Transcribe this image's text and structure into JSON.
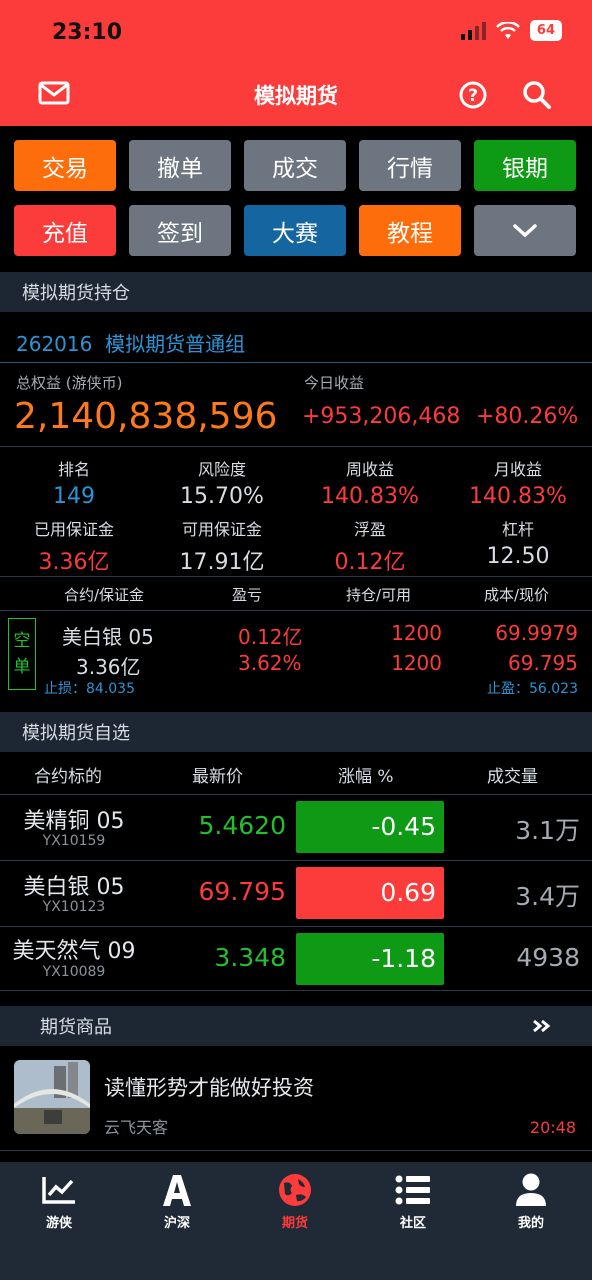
{
  "status": {
    "time": "23:10",
    "battery": "64"
  },
  "nav": {
    "title": "模拟期货"
  },
  "buttons": [
    {
      "label": "交易",
      "color": "#fd6d0c"
    },
    {
      "label": "撤单",
      "color": "#6c7580"
    },
    {
      "label": "成交",
      "color": "#6c7580"
    },
    {
      "label": "行情",
      "color": "#6c7580"
    },
    {
      "label": "银期",
      "color": "#0e9a14"
    },
    {
      "label": "充值",
      "color": "#fc3b3b"
    },
    {
      "label": "签到",
      "color": "#6c7580"
    },
    {
      "label": "大赛",
      "color": "#1565a0"
    },
    {
      "label": "教程",
      "color": "#fd6d0c"
    },
    {
      "icon": "chevron-down-icon",
      "color": "#6c7580"
    }
  ],
  "holdings": {
    "section_title": "模拟期货持仓",
    "account_id": "262016",
    "account_group": "模拟期货普通组",
    "equity_label": "总权益 (游侠币)",
    "equity": "2,140,838,596",
    "today_label": "今日收益",
    "today_amount": "+953,206,468",
    "today_pct": "+80.26%",
    "stats": [
      {
        "label": "排名",
        "value": "149"
      },
      {
        "label": "风险度",
        "value": "15.70%"
      },
      {
        "label": "周收益",
        "value": "140.83%"
      },
      {
        "label": "月收益",
        "value": "140.83%"
      },
      {
        "label": "已用保证金",
        "value": "3.36亿"
      },
      {
        "label": "可用保证金",
        "value": "17.91亿"
      },
      {
        "label": "浮盈",
        "value": "0.12亿"
      },
      {
        "label": "杠杆",
        "value": "12.50"
      }
    ],
    "columns": [
      "合约/保证金",
      "盈亏",
      "持仓/可用",
      "成本/现价"
    ],
    "position": {
      "side_tag": [
        "空",
        "单"
      ],
      "name": "美白银 05",
      "margin": "3.36亿",
      "pnl": "0.12亿",
      "pnl_pct": "3.62%",
      "hold": "1200",
      "avail": "1200",
      "cost": "69.9979",
      "price": "69.795",
      "stop_loss": "止损：84.035",
      "take_profit": "止盈：56.023"
    }
  },
  "watchlist": {
    "section_title": "模拟期货自选",
    "columns": [
      "合约标的",
      "最新价",
      "涨幅 %",
      "成交量"
    ],
    "rows": [
      {
        "name": "美精铜 05",
        "code": "YX10159",
        "price": "5.4620",
        "change": "-0.45",
        "volume": "3.1万",
        "direction": "down"
      },
      {
        "name": "美白银 05",
        "code": "YX10123",
        "price": "69.795",
        "change": "0.69",
        "volume": "3.4万",
        "direction": "up"
      },
      {
        "name": "美天然气 09",
        "code": "YX10089",
        "price": "3.348",
        "change": "-1.18",
        "volume": "4938",
        "direction": "down"
      }
    ]
  },
  "goods": {
    "section_title": "期货商品",
    "news": {
      "title": "读懂形势才能做好投资",
      "source": "云飞天客",
      "time": "20:48"
    }
  },
  "tabs": [
    {
      "label": "游侠",
      "icon": "chart-line-icon",
      "active": false
    },
    {
      "label": "沪深",
      "icon": "letter-a-icon",
      "active": false
    },
    {
      "label": "期货",
      "icon": "globe-icon",
      "active": true
    },
    {
      "label": "社区",
      "icon": "list-icon",
      "active": false
    },
    {
      "label": "我的",
      "icon": "user-icon",
      "active": false
    }
  ],
  "colors": {
    "brand_red": "#fc3b3b",
    "up_red": "#fc3b3b",
    "down_green": "#22c02c",
    "link_blue": "#2a95d6",
    "equity_orange": "#fd7a1c"
  }
}
